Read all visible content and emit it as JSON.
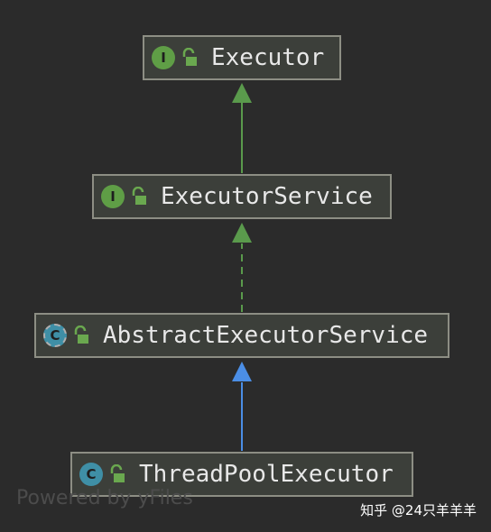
{
  "nodes": {
    "executor": {
      "badge": "I",
      "kind": "interface",
      "name": "Executor"
    },
    "executor_service": {
      "badge": "I",
      "kind": "interface",
      "name": "ExecutorService"
    },
    "abstract_executor_service": {
      "badge": "C",
      "kind": "abstract class",
      "name": "AbstractExecutorService"
    },
    "thread_pool_executor": {
      "badge": "C",
      "kind": "class",
      "name": "ThreadPoolExecutor"
    }
  },
  "edges": [
    {
      "from": "executor_service",
      "to": "executor",
      "style": "solid",
      "color": "#5a9a4c"
    },
    {
      "from": "abstract_executor_service",
      "to": "executor_service",
      "style": "dashed",
      "color": "#5a9a4c"
    },
    {
      "from": "thread_pool_executor",
      "to": "abstract_executor_service",
      "style": "solid",
      "color": "#4b8ee6"
    }
  ],
  "colors": {
    "background": "#2b2b2b",
    "node_fill": "#3c3f3a",
    "node_border": "#8d8e84",
    "interface_badge": "#5f9e46",
    "class_badge": "#3f8fa6",
    "lock_icon": "#6aa84f"
  },
  "watermark": "Powered by yFiles",
  "credit": "知乎 @24只羊羊羊"
}
